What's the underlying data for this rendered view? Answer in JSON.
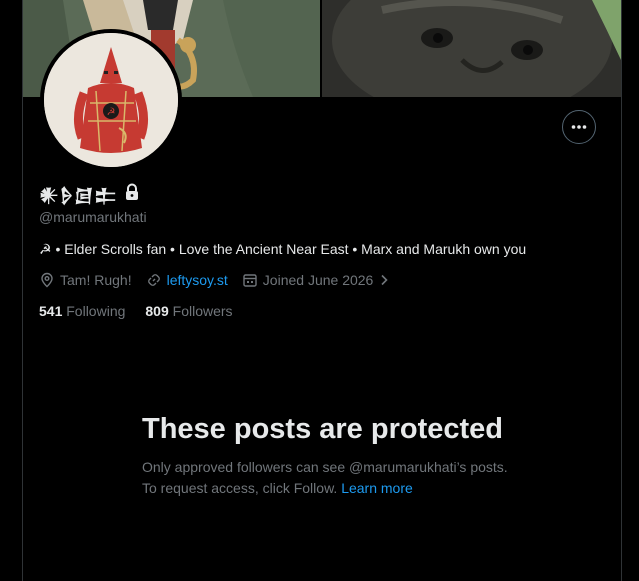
{
  "profile": {
    "display_name": "𒀭𒊩𒌆𒉺",
    "handle": "@marumarukhati",
    "bio": "☭ • Elder Scrolls fan • Love the Ancient Near East • Marx and Marukh own you",
    "location": "Tam! Rugh!",
    "website": "leftysoy.st",
    "joined": "Joined June 2026",
    "following_count": "541",
    "following_label": "Following",
    "followers_count": "809",
    "followers_label": "Followers",
    "more_label": "•••"
  },
  "protected": {
    "title": "These posts are protected",
    "description": "Only approved followers can see @marumarukhati’s posts. To request access, click Follow.",
    "learn_more": "Learn more"
  },
  "icons": {
    "lock": "lock-icon",
    "location": "location-pin-icon",
    "link": "link-icon",
    "calendar": "calendar-icon",
    "chevron": "chevron-right-icon",
    "more": "more-horizontal-icon"
  },
  "colors": {
    "background": "#000000",
    "text": "#e7e9ea",
    "secondary": "#71767b",
    "accent": "#1d9bf0",
    "border": "#2f3336"
  }
}
